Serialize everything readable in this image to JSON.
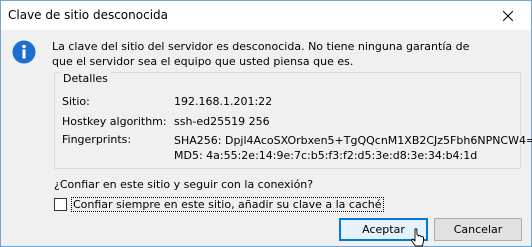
{
  "window": {
    "title": "Clave de sitio desconocida"
  },
  "message": {
    "line1": "La clave del sitio del servidor es desconocida. No tiene ninguna garantía de",
    "line2": "que el servidor sea el equipo que usted piensa que es."
  },
  "details": {
    "legend": "Detalles",
    "site_label": "Sitio:",
    "site_value": "192.168.1.201:22",
    "hostkey_label": "Hostkey algorithm:",
    "hostkey_value": "ssh-ed25519 256",
    "fingerprints_label": "Fingerprints:",
    "fingerprint_sha256": "SHA256: Dpjl4AcoSXOrbxen5+TgQQcnM1XB2CJz5Fbh6NPNCW4=",
    "fingerprint_md5": "MD5: 4a:55:2e:14:9e:7c:b5:f3:f2:d5:3e:d8:3e:34:b4:1d"
  },
  "question": "¿Confiar en este sitio y seguir con la conexión?",
  "checkbox": {
    "label": "Confiar siempre en este sitio, añadir su clave a la caché",
    "checked": false
  },
  "buttons": {
    "accept": "Aceptar",
    "cancel": "Cancelar"
  },
  "icons": {
    "info": "info-icon",
    "close": "close-icon",
    "cursor": "mouse-pointer-icon"
  },
  "colors": {
    "accent": "#0078d7",
    "info_icon": "#1c6ed0",
    "window_border": "#6fa4d7"
  }
}
